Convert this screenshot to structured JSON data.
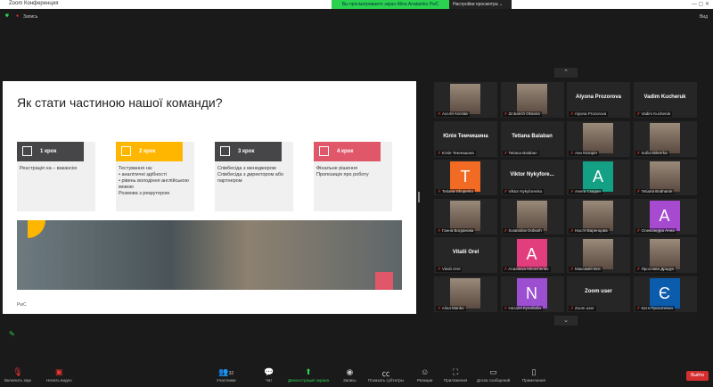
{
  "window": {
    "title": "Zoom Конференция",
    "banner": "Вы просматриваете экран Alina Anatamko PwC",
    "view_settings": "Настройки просмотра",
    "recording": "Запись",
    "view": "Вид"
  },
  "slide": {
    "title": "Як стати частиною нашої команди?",
    "footer": "PwC",
    "steps": [
      {
        "label": "1 крок",
        "color": "#464547",
        "lines": [
          "Реєстрація на – вакансію"
        ]
      },
      {
        "label": "2 крок",
        "color": "#ffb600",
        "lines": [
          "Тестування на:",
          "• аналітичні здібності",
          "• рівень володіння англійською мовою",
          "Розмова з рекрутером"
        ]
      },
      {
        "label": "3 крок",
        "color": "#464547",
        "lines": [
          "Співбесіда з менеджером",
          "Співбесіда з директором або партнером"
        ]
      },
      {
        "label": "4 крок",
        "color": "#e0576a",
        "lines": [
          "Фінальне рішення",
          "Пропозиція про роботу"
        ]
      }
    ]
  },
  "participants": [
    {
      "name": "Асєля Асєєва",
      "type": "pic"
    },
    {
      "name": "Zinbarich Oksana",
      "type": "pic"
    },
    {
      "name": "Alyona Prozorova",
      "type": "text"
    },
    {
      "name": "Vadim Kucheruk",
      "type": "text"
    },
    {
      "name": "Юлія Темчишина",
      "type": "text"
    },
    {
      "name": "Tetiana Balaban",
      "type": "text"
    },
    {
      "name": "Анн Козорін",
      "type": "pic"
    },
    {
      "name": "Sofiia Bilets'ka",
      "type": "pic"
    },
    {
      "name": "Tetiana Shuperko",
      "type": "avatar",
      "letter": "T",
      "color": "#f26b24"
    },
    {
      "name": "Viktor Nykyforenko",
      "display": "Viktor Nykyfore...",
      "type": "text"
    },
    {
      "name": "Анета Скидан",
      "type": "avatar",
      "letter": "A",
      "color": "#14a085"
    },
    {
      "name": "Tetiana Bodnaruk",
      "type": "pic"
    },
    {
      "name": "Ганна Богданова",
      "type": "pic"
    },
    {
      "name": "Sviatoslav Dobush",
      "type": "pic"
    },
    {
      "name": "Настя Варенцова",
      "type": "pic"
    },
    {
      "name": "Олександра Анна",
      "type": "avatar",
      "letter": "A",
      "color": "#a64ad0"
    },
    {
      "name": "Vitalii Orel",
      "type": "text"
    },
    {
      "name": "Anastasia Mirnichenko",
      "type": "avatar",
      "letter": "A",
      "color": "#e23d7c"
    },
    {
      "name": "Максимій Вєв",
      "type": "pic"
    },
    {
      "name": "Ярослава Драдук",
      "type": "pic"
    },
    {
      "name": "Alina Manko",
      "type": "pic"
    },
    {
      "name": "Наталя Кулибаба",
      "type": "avatar",
      "letter": "N",
      "color": "#9c4fd1"
    },
    {
      "name": "Zoom user",
      "type": "text"
    },
    {
      "name": "Катя Прокопенко",
      "type": "avatar",
      "letter": "Є",
      "color": "#0b5cad"
    }
  ],
  "toolbar": {
    "mute": "Включить звук",
    "video": "Начать видео",
    "participants": "Участники",
    "participants_count": "32",
    "chat": "Чат",
    "share": "Демонстрация экрана",
    "record": "Запись",
    "captions": "Показать субтитры",
    "reactions": "Реакции",
    "apps": "Приложения",
    "whiteboard": "Доска сообщений",
    "notes": "Примечания",
    "leave": "Выйти"
  }
}
